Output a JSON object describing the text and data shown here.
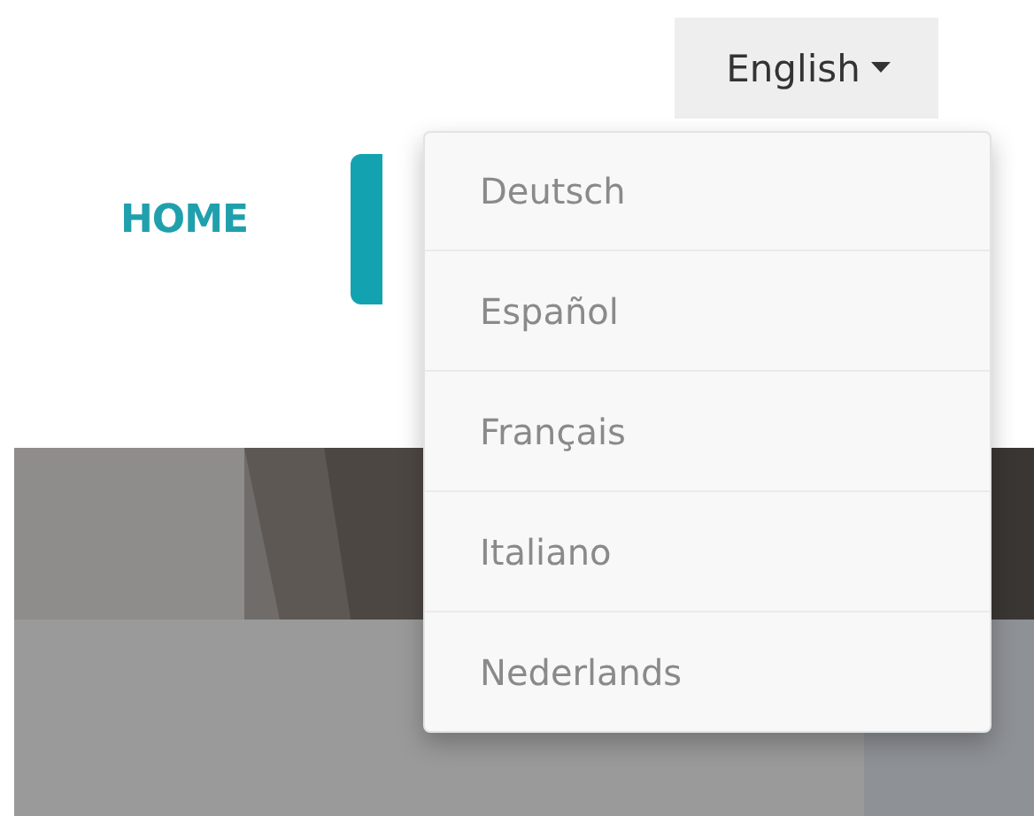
{
  "language_button": {
    "label": "English",
    "expanded": true
  },
  "nav": [
    {
      "kind": "link",
      "label": "HOME",
      "selected": false
    },
    {
      "kind": "tab",
      "selected": true
    }
  ],
  "language_menu": [
    {
      "label": "Deutsch"
    },
    {
      "label": "Español"
    },
    {
      "label": "Français"
    },
    {
      "label": "Italiano"
    },
    {
      "label": "Nederlands"
    }
  ]
}
